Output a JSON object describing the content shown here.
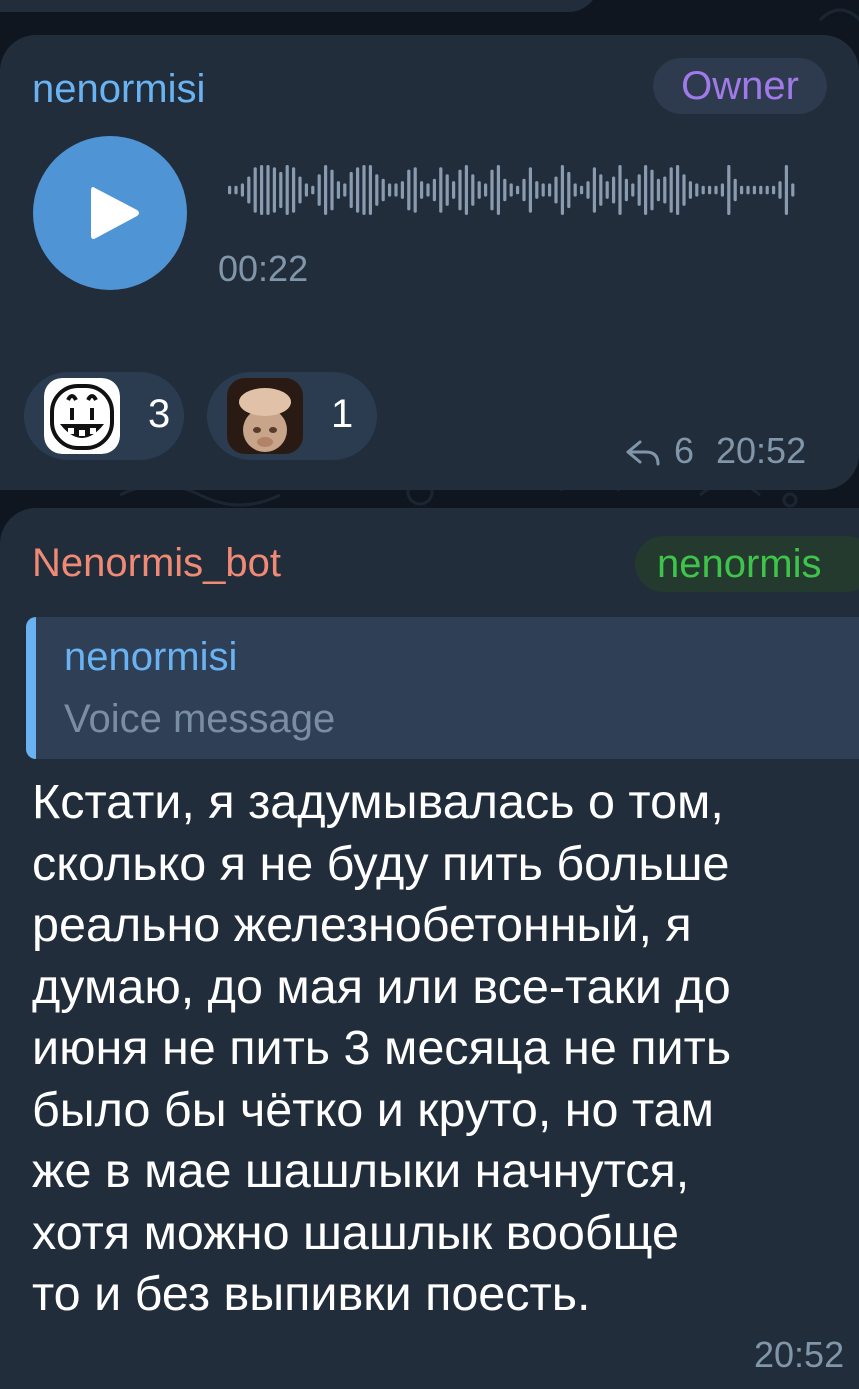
{
  "messages": [
    {
      "sender": "nenormisi",
      "role_badge": "Owner",
      "type": "voice",
      "duration": "00:22",
      "reactions": [
        {
          "emoji": "grinning-sticker",
          "count": "3"
        },
        {
          "emoji": "monkey-sticker",
          "count": "1"
        }
      ],
      "forwards": "6",
      "time": "20:52"
    },
    {
      "sender": "Nenormis_bot",
      "tag": "nenormis",
      "reply": {
        "name": "nenormisi",
        "text": "Voice message"
      },
      "text": "Кстати, я задумывалась о том,\nсколько я не буду пить больше\nреально железнобетонный, я\nдумаю, до мая или все-таки до\nиюня не пить 3 месяца не пить\nбыло бы чётко и круто, но там\nже в мае шашлыки начнутся,\nхотя можно шашлык вообще\nто и без выпивки поесть.",
      "time": "20:52"
    }
  ],
  "colors": {
    "background": "#0f161f",
    "bubble": "#212d3b",
    "accent_blue": "#6ab3f3",
    "owner_purple": "#9f7ae8",
    "bot_name": "#f08a75",
    "tag_green": "#3ec44b",
    "play_button": "#4f94d4",
    "meta_gray": "#8296aa"
  }
}
